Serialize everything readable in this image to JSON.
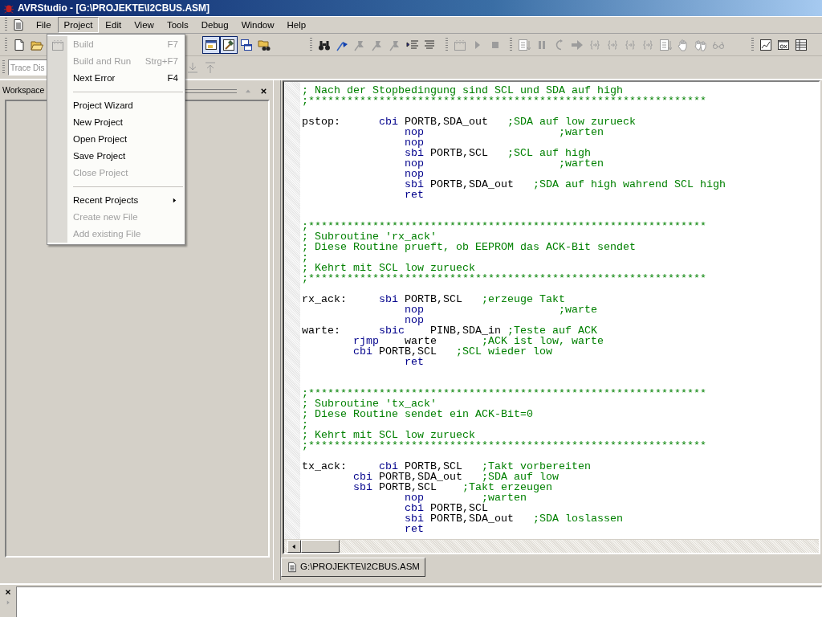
{
  "window": {
    "title": "AVRStudio - [G:\\PROJEKTE\\I2CBUS.ASM]"
  },
  "menu_bar": [
    {
      "label": "File",
      "selected": false
    },
    {
      "label": "Project",
      "selected": true
    },
    {
      "label": "Edit",
      "selected": false
    },
    {
      "label": "View",
      "selected": false
    },
    {
      "label": "Tools",
      "selected": false
    },
    {
      "label": "Debug",
      "selected": false
    },
    {
      "label": "Window",
      "selected": false
    },
    {
      "label": "Help",
      "selected": false
    }
  ],
  "project_menu": [
    {
      "kind": "item",
      "label": "Build",
      "shortcut": "F7",
      "disabled": true
    },
    {
      "kind": "item",
      "label": "Build and Run",
      "shortcut": "Strg+F7",
      "disabled": true
    },
    {
      "kind": "item",
      "label": "Next Error",
      "shortcut": "F4",
      "disabled": false
    },
    {
      "kind": "separator"
    },
    {
      "kind": "item",
      "label": "Project Wizard",
      "disabled": false
    },
    {
      "kind": "item",
      "label": "New Project",
      "disabled": false
    },
    {
      "kind": "item",
      "label": "Open Project",
      "disabled": false
    },
    {
      "kind": "item",
      "label": "Save Project",
      "disabled": false
    },
    {
      "kind": "item",
      "label": "Close Project",
      "disabled": true
    },
    {
      "kind": "separator"
    },
    {
      "kind": "submenu",
      "label": "Recent Projects",
      "disabled": false
    },
    {
      "kind": "item",
      "label": "Create new File",
      "disabled": true
    },
    {
      "kind": "item",
      "label": "Add existing File",
      "disabled": true
    }
  ],
  "toolbar_main": [
    {
      "grip": true,
      "buttons": [
        {
          "kind": "new-file",
          "pressed": false,
          "disabled": false
        },
        {
          "kind": "open-folder",
          "pressed": false,
          "disabled": false
        }
      ]
    },
    {
      "grip": false,
      "buttons": [
        {
          "kind": "window",
          "pressed": true,
          "disabled": false
        },
        {
          "kind": "hammer",
          "pressed": true,
          "disabled": false
        },
        {
          "kind": "windows",
          "pressed": false,
          "disabled": false
        },
        {
          "kind": "find-folder",
          "pressed": false,
          "disabled": false
        }
      ]
    },
    {
      "grip": true,
      "buttons": [
        {
          "kind": "binoculars",
          "pressed": false,
          "disabled": false
        },
        {
          "kind": "flag",
          "pressed": false,
          "disabled": false
        },
        {
          "kind": "bookmark",
          "pressed": false,
          "disabled": true
        },
        {
          "kind": "bookmark",
          "pressed": false,
          "disabled": true
        },
        {
          "kind": "bookmark",
          "pressed": false,
          "disabled": true
        },
        {
          "kind": "indent",
          "pressed": false,
          "disabled": false
        },
        {
          "kind": "outdent",
          "pressed": false,
          "disabled": false
        }
      ]
    },
    {
      "grip": true,
      "buttons": [
        {
          "kind": "grid",
          "pressed": false,
          "disabled": true
        },
        {
          "kind": "play",
          "pressed": false,
          "disabled": true
        },
        {
          "kind": "stop",
          "pressed": false,
          "disabled": true
        }
      ]
    },
    {
      "grip": true,
      "buttons": [
        {
          "kind": "doc-arrow",
          "pressed": false,
          "disabled": true
        },
        {
          "kind": "pause",
          "pressed": false,
          "disabled": true
        },
        {
          "kind": "reset",
          "pressed": false,
          "disabled": true
        },
        {
          "kind": "arrow",
          "pressed": false,
          "disabled": true
        },
        {
          "kind": "braces",
          "pressed": false,
          "disabled": true
        },
        {
          "kind": "braces",
          "pressed": false,
          "disabled": true
        },
        {
          "kind": "braces",
          "pressed": false,
          "disabled": true
        },
        {
          "kind": "braces",
          "pressed": false,
          "disabled": true
        },
        {
          "kind": "doc-arrow",
          "pressed": false,
          "disabled": true
        },
        {
          "kind": "hand",
          "pressed": false,
          "disabled": true
        },
        {
          "kind": "hands",
          "pressed": false,
          "disabled": true
        },
        {
          "kind": "glasses",
          "pressed": false,
          "disabled": true
        }
      ]
    },
    {
      "grip": true,
      "buttons": [
        {
          "kind": "chart-window",
          "pressed": false,
          "disabled": false
        },
        {
          "kind": "window-ox",
          "pressed": false,
          "disabled": false
        },
        {
          "kind": "table",
          "pressed": false,
          "disabled": false
        }
      ]
    }
  ],
  "trace_combo": {
    "value": "Trace Dis",
    "disabled": true
  },
  "toolbar_trace": [
    {
      "kind": "arrow-down-line",
      "disabled": true
    },
    {
      "kind": "arrow-up-line",
      "disabled": true
    }
  ],
  "workspace": {
    "title": "Workspace"
  },
  "editor": {
    "lines": [
      {
        "kind": "code",
        "text": "; Nach der Stopbedingung sind SCL und SDA auf high"
      },
      {
        "kind": "code",
        "text": ";**************************************************************"
      },
      {
        "kind": "blank"
      },
      {
        "kind": "code",
        "text": "pstop:      cbi PORTB,SDA_out   ;SDA auf low zurueck"
      },
      {
        "kind": "code",
        "text": "                nop                     ;warten"
      },
      {
        "kind": "code",
        "text": "                nop"
      },
      {
        "kind": "code",
        "text": "                sbi PORTB,SCL   ;SCL auf high"
      },
      {
        "kind": "code",
        "text": "                nop                     ;warten"
      },
      {
        "kind": "code",
        "text": "                nop"
      },
      {
        "kind": "code",
        "text": "                sbi PORTB,SDA_out   ;SDA auf high wahrend SCL high"
      },
      {
        "kind": "code",
        "text": "                ret"
      },
      {
        "kind": "blank"
      },
      {
        "kind": "blank"
      },
      {
        "kind": "code",
        "text": ";**************************************************************"
      },
      {
        "kind": "code",
        "text": "; Subroutine 'rx_ack'"
      },
      {
        "kind": "code",
        "text": "; Diese Routine prueft, ob EEPROM das ACK-Bit sendet"
      },
      {
        "kind": "code",
        "text": ";"
      },
      {
        "kind": "code",
        "text": "; Kehrt mit SCL low zurueck"
      },
      {
        "kind": "code",
        "text": ";**************************************************************"
      },
      {
        "kind": "blank"
      },
      {
        "kind": "code",
        "text": "rx_ack:     sbi PORTB,SCL   ;erzeuge Takt"
      },
      {
        "kind": "code",
        "text": "                nop                     ;warte"
      },
      {
        "kind": "code",
        "text": "                nop"
      },
      {
        "kind": "code",
        "text": "warte:      sbic    PINB,SDA_in ;Teste auf ACK"
      },
      {
        "kind": "code",
        "text": "        rjmp    warte       ;ACK ist low, warte"
      },
      {
        "kind": "code",
        "text": "        cbi PORTB,SCL   ;SCL wieder low"
      },
      {
        "kind": "code",
        "text": "                ret"
      },
      {
        "kind": "blank"
      },
      {
        "kind": "blank"
      },
      {
        "kind": "code",
        "text": ";**************************************************************"
      },
      {
        "kind": "code",
        "text": "; Subroutine 'tx_ack'"
      },
      {
        "kind": "code",
        "text": "; Diese Routine sendet ein ACK-Bit=0"
      },
      {
        "kind": "code",
        "text": ";"
      },
      {
        "kind": "code",
        "text": "; Kehrt mit SCL low zurueck"
      },
      {
        "kind": "code",
        "text": ";**************************************************************"
      },
      {
        "kind": "blank"
      },
      {
        "kind": "code",
        "text": "tx_ack:     cbi PORTB,SCL   ;Takt vorbereiten"
      },
      {
        "kind": "code",
        "text": "        cbi PORTB,SDA_out   ;SDA auf low"
      },
      {
        "kind": "code",
        "text": "        sbi PORTB,SCL    ;Takt erzeugen"
      },
      {
        "kind": "code",
        "text": "                nop         ;warten"
      },
      {
        "kind": "code",
        "text": "                cbi PORTB,SCL"
      },
      {
        "kind": "code",
        "text": "                sbi PORTB,SDA_out   ;SDA loslassen"
      },
      {
        "kind": "code",
        "text": "                ret"
      }
    ]
  },
  "document_tabs": [
    {
      "label": "G:\\PROJEKTE\\I2CBUS.ASM",
      "selected": true
    }
  ]
}
